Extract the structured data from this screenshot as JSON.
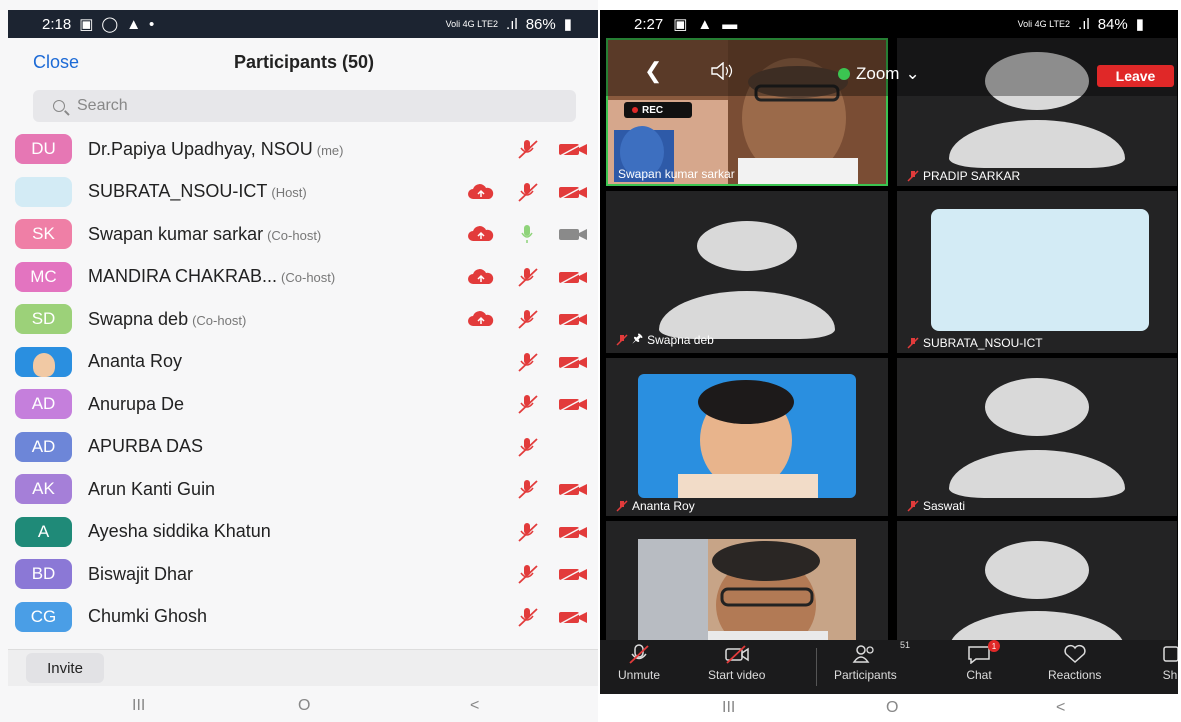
{
  "left": {
    "status": {
      "time": "2:18",
      "net": "Voli 4G LTE2",
      "battery": "86%"
    },
    "close_label": "Close",
    "title": "Participants (50)",
    "search_placeholder": "Search",
    "participants": [
      {
        "initials": "DU",
        "color": "#e677b4",
        "name": "Dr.Papiya Upadhyay, NSOU",
        "role": "(me)",
        "cloud": false,
        "mic": "muted",
        "cam": "off"
      },
      {
        "initials": "",
        "color": "#d3ebf5",
        "name": "SUBRATA_NSOU-ICT",
        "role": "(Host)",
        "cloud": true,
        "mic": "muted",
        "cam": "off"
      },
      {
        "initials": "SK",
        "color": "#ef7fa6",
        "name": "Swapan kumar sarkar",
        "role": "(Co-host)",
        "cloud": true,
        "mic": "on",
        "cam": "on"
      },
      {
        "initials": "MC",
        "color": "#e374c0",
        "name": "MANDIRA CHAKRAB...",
        "role": "(Co-host)",
        "cloud": true,
        "mic": "muted",
        "cam": "off"
      },
      {
        "initials": "SD",
        "color": "#9cd179",
        "name": "Swapna deb",
        "role": "(Co-host)",
        "cloud": true,
        "mic": "muted",
        "cam": "off"
      },
      {
        "initials": "",
        "color": "#2a8fe0",
        "photo": true,
        "name": "Ananta Roy",
        "role": "",
        "cloud": false,
        "mic": "muted",
        "cam": "off"
      },
      {
        "initials": "AD",
        "color": "#c57fdc",
        "name": "Anurupa De",
        "role": "",
        "cloud": false,
        "mic": "muted",
        "cam": "off"
      },
      {
        "initials": "AD",
        "color": "#6d86d8",
        "name": "APURBA DAS",
        "role": "",
        "cloud": false,
        "mic": "muted",
        "cam": "none"
      },
      {
        "initials": "AK",
        "color": "#a57fd8",
        "name": "Arun Kanti Guin",
        "role": "",
        "cloud": false,
        "mic": "muted",
        "cam": "off"
      },
      {
        "initials": "A",
        "color": "#1f8a78",
        "name": "Ayesha siddika Khatun",
        "role": "",
        "cloud": false,
        "mic": "muted",
        "cam": "off"
      },
      {
        "initials": "BD",
        "color": "#8b78d6",
        "name": "Biswajit Dhar",
        "role": "",
        "cloud": false,
        "mic": "muted",
        "cam": "off"
      },
      {
        "initials": "CG",
        "color": "#4a9ee6",
        "name": "Chumki Ghosh",
        "role": "",
        "cloud": false,
        "mic": "muted",
        "cam": "off"
      }
    ],
    "invite_label": "Invite"
  },
  "right": {
    "status": {
      "time": "2:27",
      "net": "Voli 4G LTE2",
      "battery": "84%"
    },
    "topbar": {
      "meeting_label": "Zoom",
      "leave_label": "Leave"
    },
    "rec_label": "REC",
    "tiles": [
      {
        "name": "Swapan kumar sarkar",
        "type": "video-speaker",
        "muted": false
      },
      {
        "name": "PRADIP SARKAR",
        "type": "avatar",
        "muted": true
      },
      {
        "name": "Swapna deb",
        "type": "avatar",
        "muted": true,
        "pinned": true
      },
      {
        "name": "SUBRATA_NSOU-ICT",
        "type": "blank",
        "muted": true
      },
      {
        "name": "Ananta Roy",
        "type": "photo",
        "muted": true
      },
      {
        "name": "Saswati",
        "type": "avatar",
        "muted": true
      },
      {
        "name": "",
        "type": "video",
        "muted": false
      },
      {
        "name": "",
        "type": "avatar",
        "muted": false
      }
    ],
    "toolbar": {
      "unmute": "Unmute",
      "start_video": "Start video",
      "participants": "Participants",
      "participants_count": "51",
      "chat": "Chat",
      "chat_badge": "1",
      "reactions": "Reactions",
      "share": "Sh"
    }
  },
  "nav": {
    "recents": "III",
    "home": "O",
    "back": "<"
  },
  "colors": {
    "zoom_blue": "#1c6ad6",
    "muted_red": "#e23b3b",
    "leave_red": "#e02828",
    "active_green": "#3bc451"
  }
}
